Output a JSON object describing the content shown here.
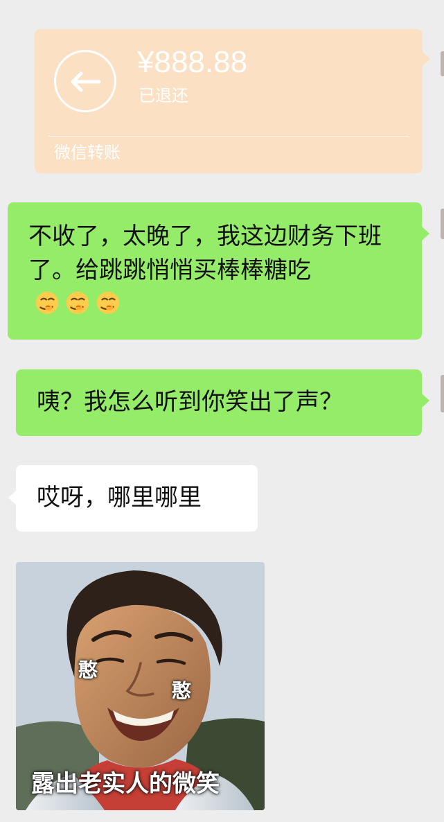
{
  "transfer": {
    "amount": "¥888.88",
    "status": "已退还",
    "service": "微信转账",
    "icon": "refund-arrow-icon",
    "card_color": "#fbe0c4"
  },
  "messages": [
    {
      "direction": "outgoing",
      "text": "不收了，太晚了，我这边财务下班了。给跳跳悄悄买棒棒糖吃",
      "emoji": [
        "smirking-hand-over-mouth",
        "smirking-hand-over-mouth",
        "smirking-hand-over-mouth"
      ]
    },
    {
      "direction": "outgoing",
      "text": "咦？我怎么听到你笑出了声？"
    },
    {
      "direction": "incoming",
      "text": "哎呀，哪里哪里"
    }
  ],
  "sticker": {
    "caption": "露出老实人的微笑",
    "tags": [
      "憨",
      "憨"
    ]
  },
  "colors": {
    "background": "#ededed",
    "outgoing_bubble": "#95ec69",
    "incoming_bubble": "#ffffff"
  }
}
